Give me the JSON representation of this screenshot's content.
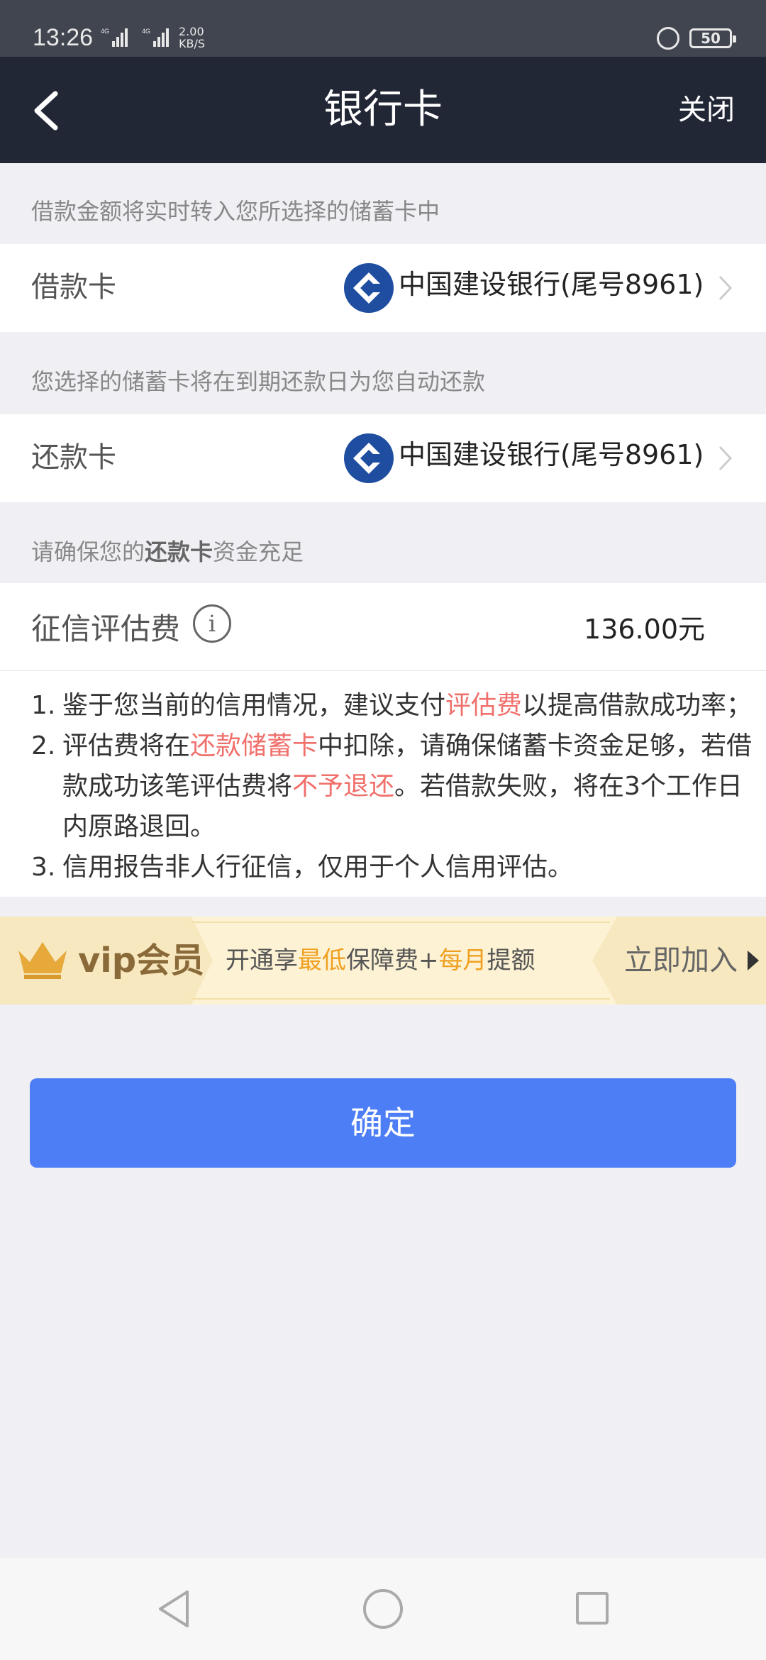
{
  "status_bar": {
    "time": "13:26",
    "net_speed_value": "2.00",
    "net_speed_unit": "KB/S",
    "network_type": "4G",
    "battery": "50"
  },
  "header": {
    "title": "银行卡",
    "close_label": "关闭"
  },
  "loan_card": {
    "hint": "借款金额将实时转入您所选择的储蓄卡中",
    "label": "借款卡",
    "bank": "中国建设银行(尾号8961)"
  },
  "repay_card": {
    "hint": "您选择的储蓄卡将在到期还款日为您自动还款",
    "label": "还款卡",
    "bank": "中国建设银行(尾号8961)"
  },
  "fund_hint": {
    "before": "请确保您的",
    "bold": "还款卡",
    "after": "资金充足"
  },
  "fee": {
    "label": "征信评估费",
    "info_glyph": "i",
    "value": "136.00元"
  },
  "notes": {
    "n1_num": "1.",
    "n1_a": "鉴于您当前的信用情况，建议支付",
    "n1_hl": "评估费",
    "n1_b": "以提高借款成功率；",
    "n2_num": "2.",
    "n2_a": "评估费将在",
    "n2_hl1": "还款储蓄卡",
    "n2_b": "中扣除，请确保储蓄卡资金足够，若借款成功该笔评估费将",
    "n2_hl2": "不予退还",
    "n2_c": "。若借款失败，将在3个工作日内原路退回。",
    "n3_num": "3.",
    "n3_a": "信用报告非人行征信，仅用于个人信用评估。"
  },
  "vip": {
    "label": "vip会员",
    "desc_a": "开通享",
    "desc_em1": "最低",
    "desc_b": "保障费+",
    "desc_em2": "每月",
    "desc_c": "提额",
    "join_label": "立即加入"
  },
  "confirm_label": "确定",
  "colors": {
    "header_bg": "#222736",
    "accent_button": "#4d7ef6",
    "highlight_text": "#f0706c",
    "vip_emphasis": "#f0a020",
    "bank_logo": "#1f4ea1"
  }
}
